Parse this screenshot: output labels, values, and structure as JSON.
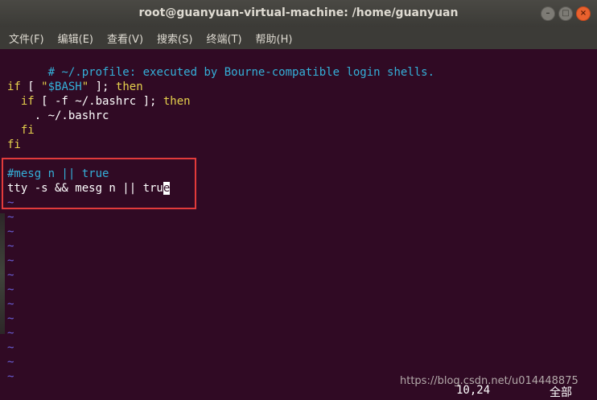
{
  "window": {
    "title": "root@guanyuan-virtual-machine: /home/guanyuan",
    "buttons": {
      "minimize": "–",
      "maximize": "□",
      "close": "×"
    }
  },
  "menu": [
    {
      "label": "文件(F)"
    },
    {
      "label": "编辑(E)"
    },
    {
      "label": "查看(V)"
    },
    {
      "label": "搜索(S)"
    },
    {
      "label": "终端(T)"
    },
    {
      "label": "帮助(H)"
    }
  ],
  "editor": {
    "line1": "# ~/.profile: executed by Bourne-compatible login shells.",
    "line3_kw1": "if",
    "line3_a": " [ ",
    "line3_str_open": "\"",
    "line3_var": "$BASH",
    "line3_str_close": "\"",
    "line3_b": " ]; ",
    "line3_kw2": "then",
    "line4_indent": "  ",
    "line4_kw1": "if",
    "line4_a": " [ -f ~/.bashrc ]; ",
    "line4_kw2": "then",
    "line5": "    . ~/.bashrc",
    "line6_indent": "  ",
    "line6_kw": "fi",
    "line7_kw": "fi",
    "line9": "#mesg n || true",
    "line10_before": "tty -s && mesg n || tru",
    "line10_cursor": "e",
    "tilde": "~",
    "tilde_count": 13
  },
  "status": {
    "position": "10,24",
    "scope": "全部"
  },
  "watermark": "https://blog.csdn.net/u014448875",
  "colors": {
    "background": "#300a24",
    "comment": "#34b0d9",
    "keyword": "#e5d04c",
    "highlight_box": "#e23b3b",
    "tilde": "#6a5fd8"
  }
}
